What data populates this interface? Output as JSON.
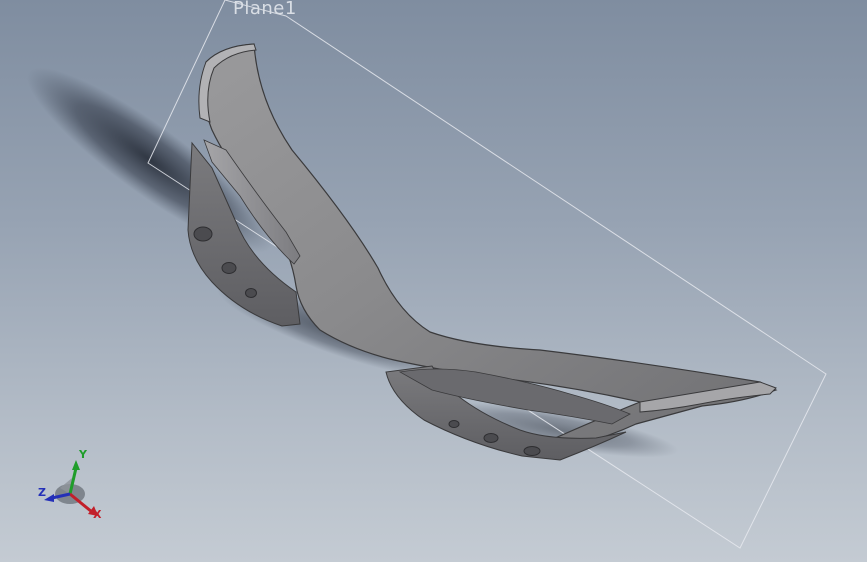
{
  "viewport": {
    "background_top": "#7f8da0",
    "background_bottom": "#c4cbd3"
  },
  "reference_plane": {
    "label": "Plane1",
    "edge_color": "#e6e9ee"
  },
  "part": {
    "body_color": "#8f8f90",
    "edge_color": "#3a3a3c"
  },
  "triad": {
    "x_label": "X",
    "y_label": "Y",
    "z_label": "Z",
    "x_color": "#c21f2a",
    "y_color": "#1f9d2a",
    "z_color": "#2430b8"
  }
}
